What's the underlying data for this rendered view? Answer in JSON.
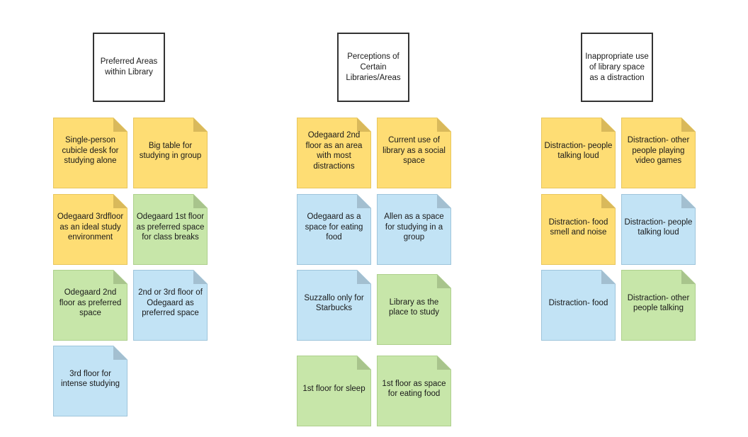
{
  "colors": {
    "yellow": {
      "fill": "#fedd74",
      "stroke": "#e8c65d",
      "fold": "#d9b95b"
    },
    "green": {
      "fill": "#c7e6a9",
      "stroke": "#aed08d",
      "fold": "#a8c48c"
    },
    "blue": {
      "fill": "#c2e3f5",
      "stroke": "#9fc5db",
      "fold": "#a3bfd0"
    }
  },
  "groups": [
    {
      "title": "Preferred Areas within Library",
      "notes": [
        {
          "text": "Single-person cubicle desk for studying alone",
          "color": "yellow"
        },
        {
          "text": "Big table for studying in group",
          "color": "yellow"
        },
        {
          "text": "Odegaard 3rdfloor as an ideal study environment",
          "color": "yellow"
        },
        {
          "text": "Odegaard 1st floor as preferred space for class breaks",
          "color": "green"
        },
        {
          "text": "Odegaard 2nd floor as preferred space",
          "color": "green"
        },
        {
          "text": "2nd or 3rd floor of Odegaard as preferred space",
          "color": "blue"
        },
        {
          "text": "3rd floor for intense studying",
          "color": "blue"
        }
      ]
    },
    {
      "title": "Perceptions of Certain Libraries/Areas",
      "notes": [
        {
          "text": "Odegaard 2nd floor as an area with most distractions",
          "color": "yellow"
        },
        {
          "text": "Current use of library as a social space",
          "color": "yellow"
        },
        {
          "text": "Odegaard as a space for eating food",
          "color": "blue"
        },
        {
          "text": "Allen as a space for studying in a group",
          "color": "blue"
        },
        {
          "text": "Suzzallo only for Starbucks",
          "color": "blue"
        },
        {
          "text": "Library as the place to study",
          "color": "green"
        },
        {
          "text": "1st floor for sleep",
          "color": "green"
        },
        {
          "text": "1st floor as space for eating food",
          "color": "green"
        }
      ]
    },
    {
      "title": "Inappropriate use of library space as a distraction",
      "notes": [
        {
          "text": "Distraction- people talking loud",
          "color": "yellow"
        },
        {
          "text": "Distraction- other people playing video games",
          "color": "yellow"
        },
        {
          "text": "Distraction- food smell and noise",
          "color": "yellow"
        },
        {
          "text": "Distraction- people talking loud",
          "color": "blue"
        },
        {
          "text": "Distraction- food",
          "color": "blue"
        },
        {
          "text": "Distraction- other people talking",
          "color": "green"
        }
      ]
    }
  ]
}
